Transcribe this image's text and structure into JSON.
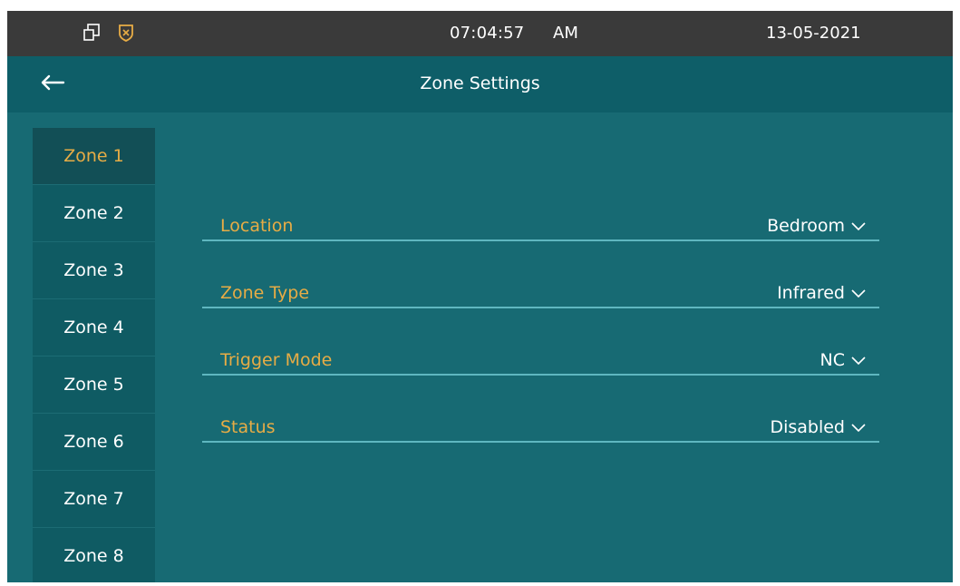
{
  "status_bar": {
    "icons": [
      "windows-icon",
      "shield-icon"
    ],
    "time": "07:04:57",
    "ampm": "AM",
    "date": "13-05-2021"
  },
  "header": {
    "back_icon": "back-arrow-icon",
    "title": "Zone Settings"
  },
  "sidebar": {
    "items": [
      {
        "label": "Zone 1",
        "active": true
      },
      {
        "label": "Zone 2",
        "active": false
      },
      {
        "label": "Zone 3",
        "active": false
      },
      {
        "label": "Zone 4",
        "active": false
      },
      {
        "label": "Zone 5",
        "active": false
      },
      {
        "label": "Zone 6",
        "active": false
      },
      {
        "label": "Zone 7",
        "active": false
      },
      {
        "label": "Zone 8",
        "active": false
      }
    ]
  },
  "settings": {
    "location": {
      "label": "Location",
      "value": "Bedroom"
    },
    "zone_type": {
      "label": "Zone Type",
      "value": "Infrared"
    },
    "trigger_mode": {
      "label": "Trigger Mode",
      "value": "NC"
    },
    "status": {
      "label": "Status",
      "value": "Disabled"
    }
  },
  "colors": {
    "status_bar_bg": "#3a3a3a",
    "title_bar_bg": "#0e5e68",
    "content_bg": "#176a73",
    "accent": "#e7ac45",
    "divider": "#5fb7c0"
  }
}
